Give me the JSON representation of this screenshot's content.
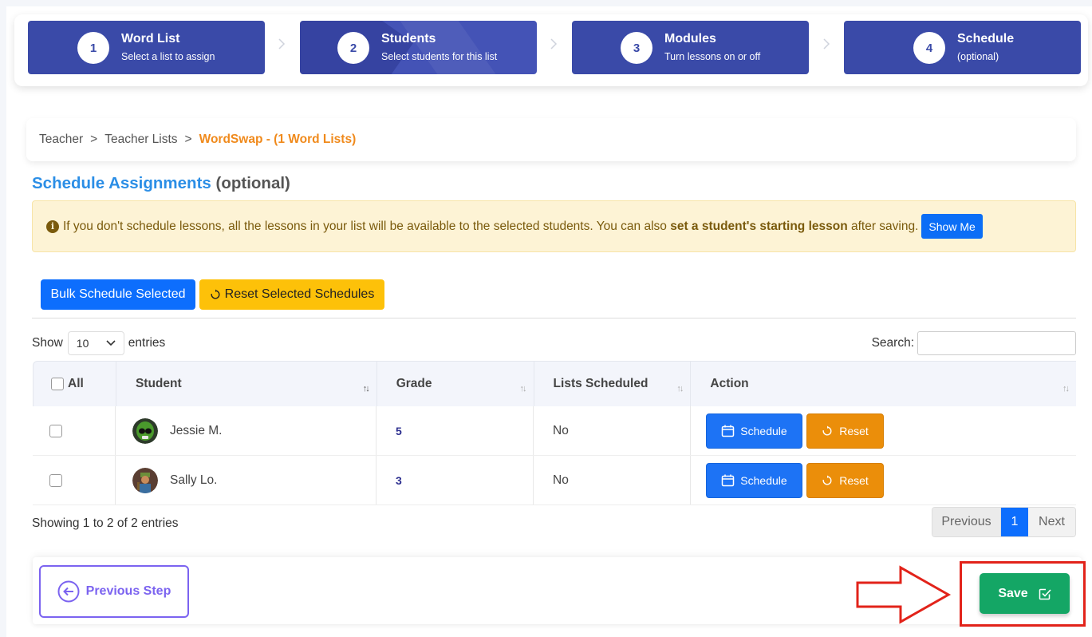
{
  "stepper": {
    "steps": [
      {
        "number": "1",
        "title": "Word List",
        "subtitle": "Select a list to assign"
      },
      {
        "number": "2",
        "title": "Students",
        "subtitle": "Select students for this list"
      },
      {
        "number": "3",
        "title": "Modules",
        "subtitle": "Turn lessons on or off"
      },
      {
        "number": "4",
        "title": "Schedule",
        "subtitle": "(optional)"
      }
    ],
    "active_step": 2
  },
  "breadcrumb": {
    "items": [
      "Teacher",
      "Teacher Lists"
    ],
    "separator": ">",
    "current": "WordSwap - (1 Word Lists)"
  },
  "section": {
    "title": "Schedule Assignments",
    "title_suffix": "(optional)"
  },
  "alert": {
    "icon": "info-icon",
    "text_before": "If you don't schedule lessons, all the lessons in your list will be available to the selected students. You can also",
    "bold_text": "set a student's starting lesson",
    "text_after": "after saving.",
    "button_label": "Show Me"
  },
  "actions": {
    "bulk_schedule_label": "Bulk Schedule Selected",
    "reset_selected_label": "Reset Selected Schedules"
  },
  "table_controls": {
    "show_label": "Show",
    "entries_value": "10",
    "entries_label": "entries",
    "search_label": "Search:",
    "search_value": ""
  },
  "table": {
    "headers": {
      "all": "All",
      "student": "Student",
      "grade": "Grade",
      "lists_scheduled": "Lists Scheduled",
      "action": "Action"
    },
    "rows": [
      {
        "student": "Jessie M.",
        "grade": "5",
        "lists_scheduled": "No",
        "schedule_label": "Schedule",
        "reset_label": "Reset"
      },
      {
        "student": "Sally Lo.",
        "grade": "3",
        "lists_scheduled": "No",
        "schedule_label": "Schedule",
        "reset_label": "Reset"
      }
    ]
  },
  "pagination": {
    "info": "Showing 1 to 2 of 2 entries",
    "previous": "Previous",
    "current_page": "1",
    "next": "Next"
  },
  "footer": {
    "previous_step_label": "Previous Step",
    "save_label": "Save"
  },
  "colors": {
    "stepper_bg": "#3a4aa8",
    "primary_blue": "#0d6efd",
    "warning_yellow": "#fdc109",
    "reset_orange": "#eb8e0a",
    "save_green": "#14a665",
    "breadcrumb_current": "#f08a1c",
    "title_blue": "#2b8ee6",
    "annotation_red": "#e2231a"
  }
}
